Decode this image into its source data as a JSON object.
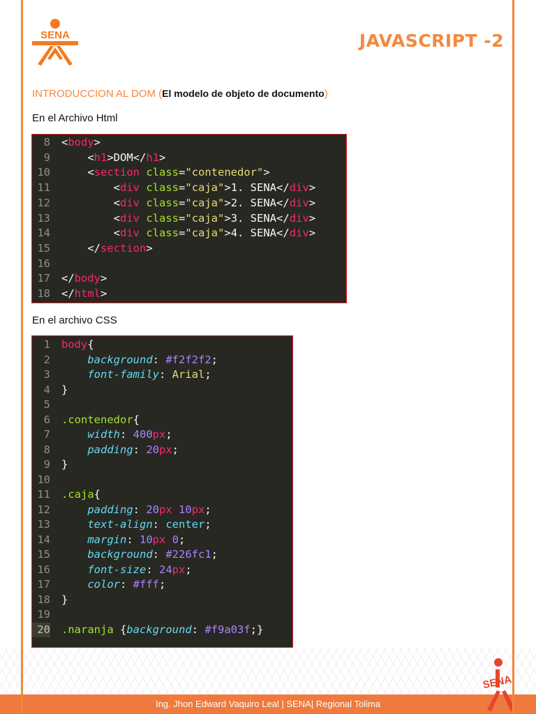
{
  "header": {
    "logo_text": "SENA",
    "title": "JAVASCRIPT -2"
  },
  "intro": {
    "heading": "INTRODUCCION AL DOM (",
    "subtitle": "El modelo de objeto de documento",
    "close": ")"
  },
  "html_label": "En el Archivo Html",
  "css_label": "En el archivo CSS",
  "html_code": [
    {
      "n": "8",
      "t": [
        [
          "<",
          "txt"
        ],
        [
          "body",
          "tag"
        ],
        [
          ">",
          "txt"
        ]
      ]
    },
    {
      "n": "9",
      "t": [
        [
          "    <",
          "txt"
        ],
        [
          "h1",
          "tag"
        ],
        [
          ">DOM</",
          "txt"
        ],
        [
          "h1",
          "tag"
        ],
        [
          ">",
          "txt"
        ]
      ]
    },
    {
      "n": "10",
      "t": [
        [
          "    <",
          "txt"
        ],
        [
          "section",
          "tag"
        ],
        [
          " ",
          "txt"
        ],
        [
          "class",
          "attr"
        ],
        [
          "=",
          "txt"
        ],
        [
          "\"contenedor\"",
          "str"
        ],
        [
          ">",
          "txt"
        ]
      ]
    },
    {
      "n": "11",
      "t": [
        [
          "        <",
          "txt"
        ],
        [
          "div",
          "tag"
        ],
        [
          " ",
          "txt"
        ],
        [
          "class",
          "attr"
        ],
        [
          "=",
          "txt"
        ],
        [
          "\"caja\"",
          "str"
        ],
        [
          ">1. SENA</",
          "txt"
        ],
        [
          "div",
          "tag"
        ],
        [
          ">",
          "txt"
        ]
      ]
    },
    {
      "n": "12",
      "t": [
        [
          "        <",
          "txt"
        ],
        [
          "div",
          "tag"
        ],
        [
          " ",
          "txt"
        ],
        [
          "class",
          "attr"
        ],
        [
          "=",
          "txt"
        ],
        [
          "\"caja\"",
          "str"
        ],
        [
          ">2. SENA</",
          "txt"
        ],
        [
          "div",
          "tag"
        ],
        [
          ">",
          "txt"
        ]
      ]
    },
    {
      "n": "13",
      "t": [
        [
          "        <",
          "txt"
        ],
        [
          "div",
          "tag"
        ],
        [
          " ",
          "txt"
        ],
        [
          "class",
          "attr"
        ],
        [
          "=",
          "txt"
        ],
        [
          "\"caja\"",
          "str"
        ],
        [
          ">3. SENA</",
          "txt"
        ],
        [
          "div",
          "tag"
        ],
        [
          ">",
          "txt"
        ]
      ]
    },
    {
      "n": "14",
      "t": [
        [
          "        <",
          "txt"
        ],
        [
          "div",
          "tag"
        ],
        [
          " ",
          "txt"
        ],
        [
          "class",
          "attr"
        ],
        [
          "=",
          "txt"
        ],
        [
          "\"caja\"",
          "str"
        ],
        [
          ">4. SENA</",
          "txt"
        ],
        [
          "div",
          "tag"
        ],
        [
          ">",
          "txt"
        ]
      ]
    },
    {
      "n": "15",
      "t": [
        [
          "    </",
          "txt"
        ],
        [
          "section",
          "tag"
        ],
        [
          ">",
          "txt"
        ]
      ]
    },
    {
      "n": "16",
      "t": []
    },
    {
      "n": "17",
      "t": [
        [
          "</",
          "txt"
        ],
        [
          "body",
          "tag"
        ],
        [
          ">",
          "txt"
        ]
      ]
    },
    {
      "n": "18",
      "t": [
        [
          "</",
          "txt"
        ],
        [
          "html",
          "tag"
        ],
        [
          ">",
          "txt"
        ]
      ]
    }
  ],
  "css_code": [
    {
      "n": "1",
      "t": [
        [
          "body",
          "tag"
        ],
        [
          "{",
          "txt"
        ]
      ]
    },
    {
      "n": "2",
      "t": [
        [
          "    ",
          "txt"
        ],
        [
          "background",
          "prop"
        ],
        [
          ": ",
          "txt"
        ],
        [
          "#f2f2f2",
          "num"
        ],
        [
          ";",
          "txt"
        ]
      ]
    },
    {
      "n": "3",
      "t": [
        [
          "    ",
          "txt"
        ],
        [
          "font-family",
          "prop"
        ],
        [
          ": ",
          "txt"
        ],
        [
          "Arial",
          "str"
        ],
        [
          ";",
          "txt"
        ]
      ]
    },
    {
      "n": "4",
      "t": [
        [
          "}",
          "txt"
        ]
      ]
    },
    {
      "n": "5",
      "t": []
    },
    {
      "n": "6",
      "t": [
        [
          ".contenedor",
          "sel"
        ],
        [
          "{",
          "txt"
        ]
      ]
    },
    {
      "n": "7",
      "t": [
        [
          "    ",
          "txt"
        ],
        [
          "width",
          "prop"
        ],
        [
          ": ",
          "txt"
        ],
        [
          "400",
          "num"
        ],
        [
          "px",
          "unit"
        ],
        [
          ";",
          "txt"
        ]
      ]
    },
    {
      "n": "8",
      "t": [
        [
          "    ",
          "txt"
        ],
        [
          "padding",
          "prop"
        ],
        [
          ": ",
          "txt"
        ],
        [
          "20",
          "num"
        ],
        [
          "px",
          "unit"
        ],
        [
          ";",
          "txt"
        ]
      ]
    },
    {
      "n": "9",
      "t": [
        [
          "}",
          "txt"
        ]
      ]
    },
    {
      "n": "10",
      "t": []
    },
    {
      "n": "11",
      "t": [
        [
          ".caja",
          "sel"
        ],
        [
          "{",
          "txt"
        ]
      ]
    },
    {
      "n": "12",
      "t": [
        [
          "    ",
          "txt"
        ],
        [
          "padding",
          "prop"
        ],
        [
          ": ",
          "txt"
        ],
        [
          "20",
          "num"
        ],
        [
          "px",
          "unit"
        ],
        [
          " ",
          "txt"
        ],
        [
          "10",
          "num"
        ],
        [
          "px",
          "unit"
        ],
        [
          ";",
          "txt"
        ]
      ]
    },
    {
      "n": "13",
      "t": [
        [
          "    ",
          "txt"
        ],
        [
          "text-align",
          "prop"
        ],
        [
          ": ",
          "txt"
        ],
        [
          "center",
          "prop2"
        ],
        [
          ";",
          "txt"
        ]
      ]
    },
    {
      "n": "14",
      "t": [
        [
          "    ",
          "txt"
        ],
        [
          "margin",
          "prop"
        ],
        [
          ": ",
          "txt"
        ],
        [
          "10",
          "num"
        ],
        [
          "px",
          "unit"
        ],
        [
          " ",
          "txt"
        ],
        [
          "0",
          "num"
        ],
        [
          ";",
          "txt"
        ]
      ]
    },
    {
      "n": "15",
      "t": [
        [
          "    ",
          "txt"
        ],
        [
          "background",
          "prop"
        ],
        [
          ": ",
          "txt"
        ],
        [
          "#226fc1",
          "num"
        ],
        [
          ";",
          "txt"
        ]
      ]
    },
    {
      "n": "16",
      "t": [
        [
          "    ",
          "txt"
        ],
        [
          "font-size",
          "prop"
        ],
        [
          ": ",
          "txt"
        ],
        [
          "24",
          "num"
        ],
        [
          "px",
          "unit"
        ],
        [
          ";",
          "txt"
        ]
      ]
    },
    {
      "n": "17",
      "t": [
        [
          "    ",
          "txt"
        ],
        [
          "color",
          "prop"
        ],
        [
          ": ",
          "txt"
        ],
        [
          "#fff",
          "num"
        ],
        [
          ";",
          "txt"
        ]
      ]
    },
    {
      "n": "18",
      "t": [
        [
          "}",
          "txt"
        ]
      ]
    },
    {
      "n": "19",
      "t": []
    },
    {
      "n": "20",
      "t": [
        [
          ".naranja",
          "sel"
        ],
        [
          " {",
          "txt"
        ],
        [
          "background",
          "prop"
        ],
        [
          ": ",
          "txt"
        ],
        [
          "#f9a03f",
          "num"
        ],
        [
          ";}",
          "txt"
        ]
      ],
      "current": true
    }
  ],
  "footer": {
    "credit": "Ing. Jhon Edward Vaquiro Leal | SENA| Regional Tolima",
    "logo_text": "SENA"
  },
  "colors": {
    "accent": "#f4883c",
    "footer": "#ee7a3d",
    "editor_bg": "#272822"
  }
}
